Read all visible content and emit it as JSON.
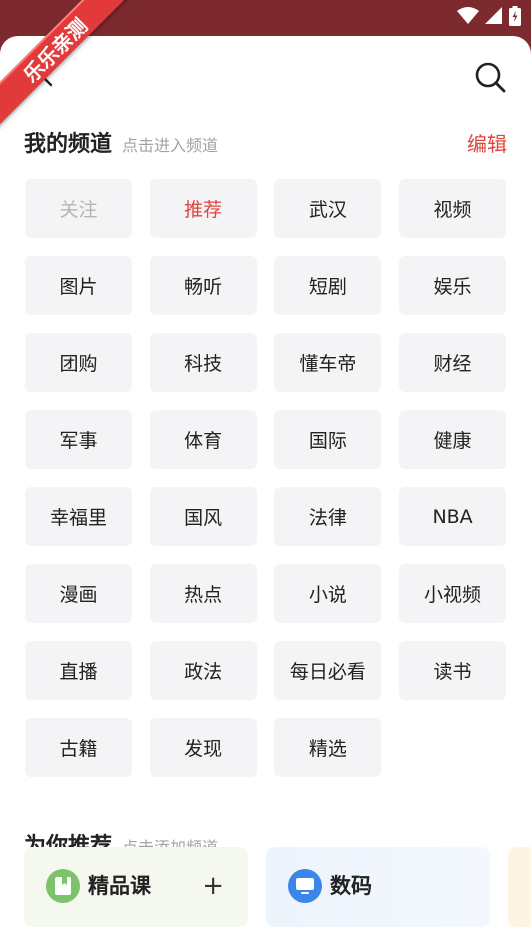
{
  "watermark": "乐乐亲测",
  "header": {
    "close_icon": "close-icon",
    "search_icon": "search-icon"
  },
  "my_channels": {
    "title": "我的频道",
    "subtitle": "点击进入频道",
    "edit_label": "编辑",
    "items": [
      {
        "label": "关注",
        "state": "disabled"
      },
      {
        "label": "推荐",
        "state": "active"
      },
      {
        "label": "武汉",
        "state": "normal"
      },
      {
        "label": "视频",
        "state": "normal"
      },
      {
        "label": "图片",
        "state": "normal"
      },
      {
        "label": "畅听",
        "state": "normal"
      },
      {
        "label": "短剧",
        "state": "normal"
      },
      {
        "label": "娱乐",
        "state": "normal"
      },
      {
        "label": "团购",
        "state": "normal"
      },
      {
        "label": "科技",
        "state": "normal"
      },
      {
        "label": "懂车帝",
        "state": "normal"
      },
      {
        "label": "财经",
        "state": "normal"
      },
      {
        "label": "军事",
        "state": "normal"
      },
      {
        "label": "体育",
        "state": "normal"
      },
      {
        "label": "国际",
        "state": "normal"
      },
      {
        "label": "健康",
        "state": "normal"
      },
      {
        "label": "幸福里",
        "state": "normal"
      },
      {
        "label": "国风",
        "state": "normal"
      },
      {
        "label": "法律",
        "state": "normal"
      },
      {
        "label": "NBA",
        "state": "normal"
      },
      {
        "label": "漫画",
        "state": "normal"
      },
      {
        "label": "热点",
        "state": "normal"
      },
      {
        "label": "小说",
        "state": "normal"
      },
      {
        "label": "小视频",
        "state": "normal"
      },
      {
        "label": "直播",
        "state": "normal"
      },
      {
        "label": "政法",
        "state": "normal"
      },
      {
        "label": "每日必看",
        "state": "normal"
      },
      {
        "label": "读书",
        "state": "normal"
      },
      {
        "label": "古籍",
        "state": "normal"
      },
      {
        "label": "发现",
        "state": "normal"
      },
      {
        "label": "精选",
        "state": "normal"
      }
    ]
  },
  "recommended": {
    "title": "为你推荐",
    "subtitle": "点击添加频道",
    "cards": [
      {
        "label": "精品课",
        "icon": "bookmark-icon",
        "color": "#7dc36b",
        "add": "+"
      },
      {
        "label": "数码",
        "icon": "monitor-icon",
        "color": "#3b86e8"
      }
    ]
  },
  "colors": {
    "accent_red": "#e0463e",
    "status_bar": "#7d2a2e",
    "chip_bg": "#f4f4f6"
  }
}
